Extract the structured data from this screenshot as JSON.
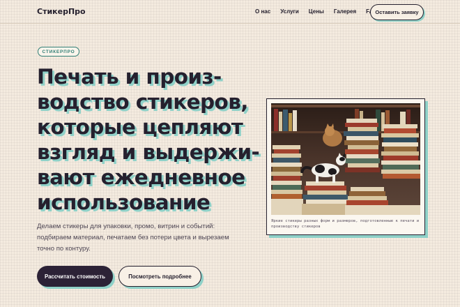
{
  "brand": {
    "logo": "СтикерПро"
  },
  "nav": {
    "items": [
      "О нас",
      "Услуги",
      "Цены",
      "Галерея",
      "FAQ"
    ],
    "cta_label": "Оставить заявку"
  },
  "hero": {
    "badge": "СТИКЕРПРО",
    "headline_lines": [
      "Печать и произ-",
      "водство стикеров,",
      "которые цепляют",
      "взгляд и выдержи-",
      "вают ежедневное",
      "использование"
    ],
    "lead": "Делаем стикеры для упаковки, промо, витрин и событий: подбираем материал, печатаем без потери цвета и вырезаем точно по контуру.",
    "primary_button": "Рассчитать стоимость",
    "secondary_button": "Посмотреть подробнее"
  },
  "figure": {
    "caption": "Яркие стикеры разных форм и размеров, подготовленные к печати и производству стикеров",
    "photo_icon": "photo-books-cat"
  },
  "colors": {
    "ink": "#25202e",
    "accent_shadow": "#8fd1c8",
    "badge_teal": "#2f7d74",
    "background": "#f4ebdf",
    "primary_button": "#2c2236"
  }
}
